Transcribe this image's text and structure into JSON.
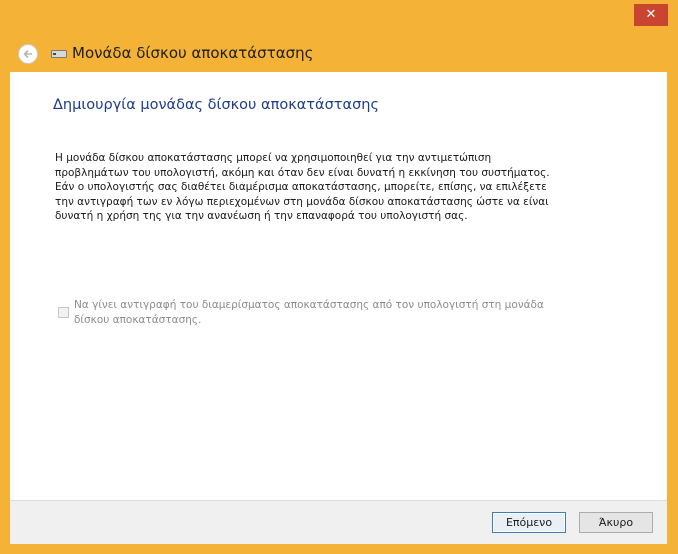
{
  "window": {
    "title": "Μονάδα δίσκου αποκατάστασης",
    "close_glyph": "✕"
  },
  "main": {
    "heading": "Δημιουργία μονάδας δίσκου αποκατάστασης",
    "description_lines": [
      "Η μονάδα δίσκου αποκατάστασης μπορεί να χρησιμοποιηθεί για την αντιμετώπιση",
      "προβλημάτων του υπολογιστή, ακόμη και όταν δεν είναι δυνατή η εκκίνηση του συστήματος.",
      "Εάν ο υπολογιστής σας διαθέτει διαμέρισμα αποκατάστασης, μπορείτε, επίσης, να επιλέξετε",
      "την αντιγραφή των εν λόγω περιεχομένων στη μονάδα δίσκου αποκατάστασης ώστε να είναι",
      "δυνατή η χρήση της για την ανανέωση ή την επαναφορά του υπολογιστή σας."
    ],
    "checkbox": {
      "checked": false,
      "enabled": false,
      "label_lines": [
        "Να γίνει αντιγραφή του διαμερίσματος αποκατάστασης από τον υπολογιστή στη μονάδα",
        "δίσκου αποκατάστασης."
      ]
    }
  },
  "footer": {
    "next_label": "Επόμενο",
    "cancel_label": "Άκυρο"
  },
  "colors": {
    "frame": "#f4b236",
    "close_button": "#c9452f",
    "heading": "#1e3c8c"
  },
  "icons": {
    "back": "back-arrow-icon",
    "drive": "drive-icon",
    "close": "close-icon"
  }
}
